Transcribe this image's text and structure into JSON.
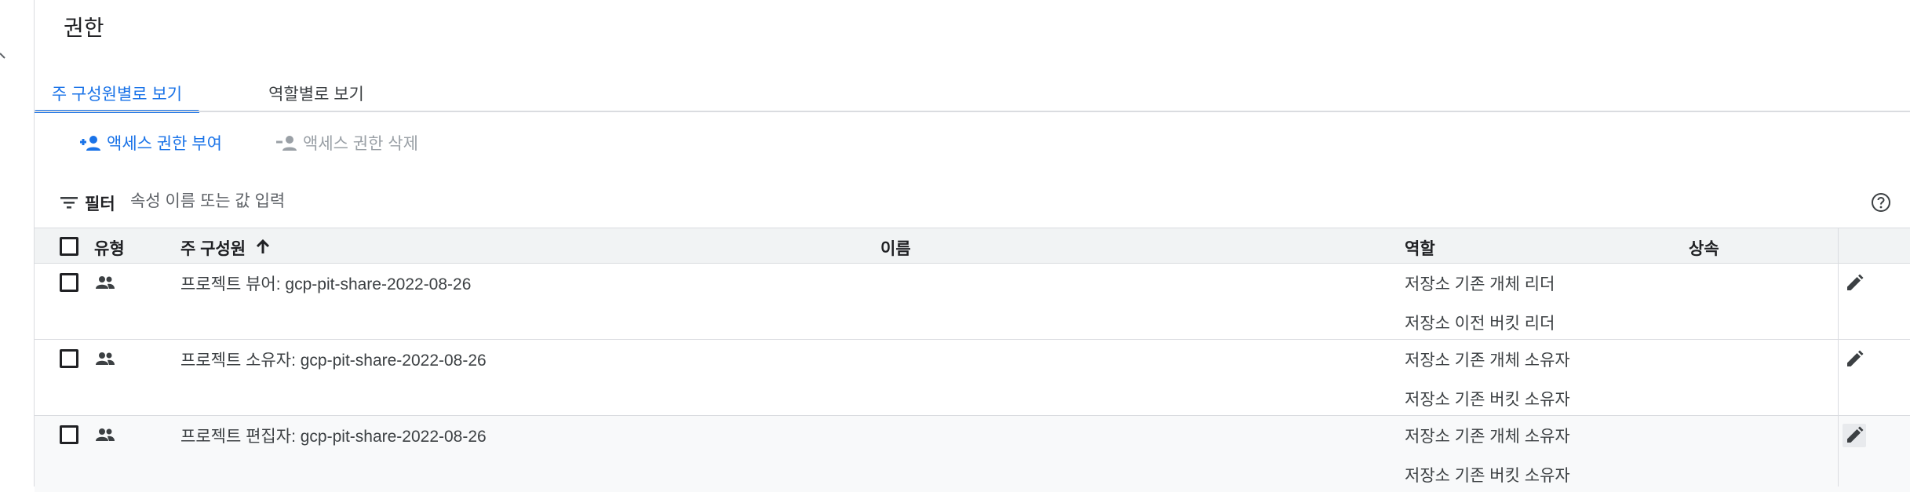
{
  "page": {
    "title": "권한"
  },
  "tabs": [
    {
      "label": "주 구성원별로 보기",
      "active": true
    },
    {
      "label": "역할별로 보기",
      "active": false
    }
  ],
  "actions": {
    "grant_label": "액세스 권한 부여",
    "remove_label": "액세스 권한 삭제"
  },
  "filter": {
    "label": "필터",
    "placeholder": "속성 이름 또는 값 입력"
  },
  "table": {
    "headers": {
      "type": "유형",
      "principal": "주 구성원",
      "name": "이름",
      "role": "역할",
      "inheritance": "상속"
    },
    "sort": {
      "column": "principal",
      "direction": "ascending"
    },
    "rows": [
      {
        "principal": "프로젝트 뷰어: gcp-pit-share-2022-08-26",
        "name": "",
        "roles": [
          "저장소 기존 개체 리더",
          "저장소 이전 버킷 리더"
        ]
      },
      {
        "principal": "프로젝트 소유자: gcp-pit-share-2022-08-26",
        "name": "",
        "roles": [
          "저장소 기존 개체 소유자",
          "저장소 기존 버킷 소유자"
        ]
      },
      {
        "principal": "프로젝트 편집자: gcp-pit-share-2022-08-26",
        "name": "",
        "roles": [
          "저장소 기존 개체 소유자",
          "저장소 기존 버킷 소유자"
        ]
      }
    ]
  },
  "icons": {
    "grant": "person-add-icon",
    "remove": "person-remove-icon",
    "filter": "filter-list-icon",
    "help": "help-outline-icon",
    "sort": "arrow-upward-icon",
    "row_type": "group-icon",
    "edit": "edit-pencil-icon"
  },
  "colors": {
    "accent": "#1a73e8",
    "header_bg": "#f1f3f4",
    "disabled": "#9aa0a6",
    "divider": "#dadce0"
  }
}
